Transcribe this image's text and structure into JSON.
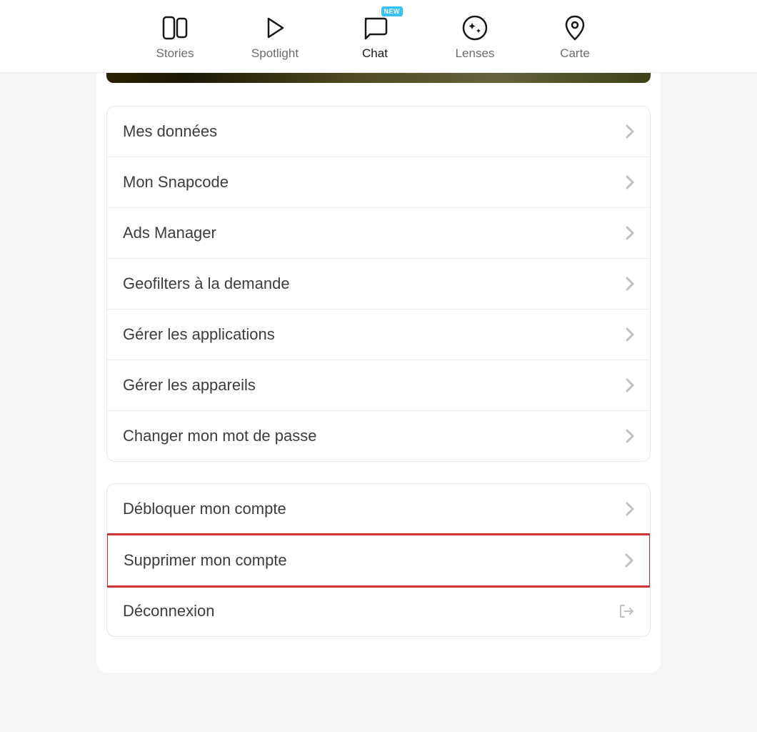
{
  "nav": {
    "items": [
      {
        "id": "stories",
        "label": "Stories"
      },
      {
        "id": "spotlight",
        "label": "Spotlight"
      },
      {
        "id": "chat",
        "label": "Chat",
        "badge": "NEW"
      },
      {
        "id": "lenses",
        "label": "Lenses"
      },
      {
        "id": "map",
        "label": "Carte"
      }
    ]
  },
  "group1": {
    "items": [
      {
        "label": "Mes données"
      },
      {
        "label": "Mon Snapcode"
      },
      {
        "label": "Ads Manager"
      },
      {
        "label": "Geofilters à la demande"
      },
      {
        "label": "Gérer les applications"
      },
      {
        "label": "Gérer les appareils"
      },
      {
        "label": "Changer mon mot de passe"
      }
    ]
  },
  "group2": {
    "items": [
      {
        "label": "Débloquer mon compte"
      },
      {
        "label": "Supprimer mon compte",
        "highlighted": true
      },
      {
        "label": "Déconnexion",
        "type": "logout"
      }
    ]
  }
}
